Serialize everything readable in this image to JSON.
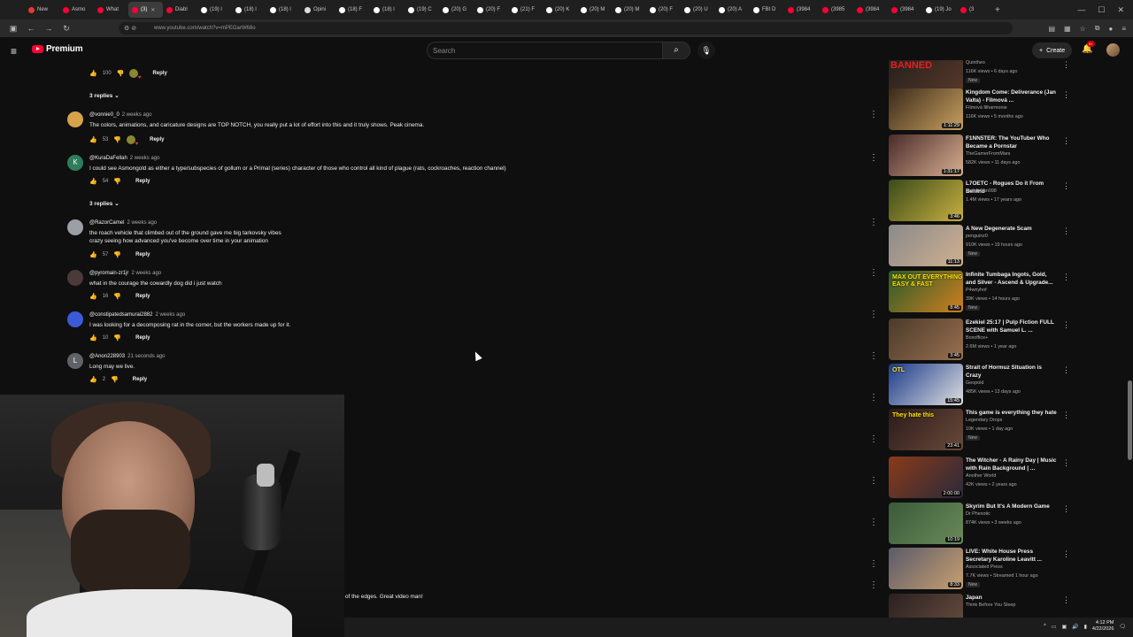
{
  "browser": {
    "tabs": [
      {
        "label": "New",
        "color": "#e03c31"
      },
      {
        "label": "Asmo",
        "color": "#ff0033"
      },
      {
        "label": "What",
        "color": "#ff0033"
      },
      {
        "label": "(3)",
        "color": "#ff0033",
        "active": true
      },
      {
        "label": "Diabl",
        "color": "#ff0033"
      },
      {
        "label": "(19) l",
        "color": "#ffffff"
      },
      {
        "label": "(18) l",
        "color": "#ffffff"
      },
      {
        "label": "(18) l",
        "color": "#ffffff"
      },
      {
        "label": "Opini",
        "color": "#dddddd"
      },
      {
        "label": "(18) F",
        "color": "#ffffff"
      },
      {
        "label": "(18) l",
        "color": "#ffffff"
      },
      {
        "label": "(19) C",
        "color": "#ffffff"
      },
      {
        "label": "(20) G",
        "color": "#ffffff"
      },
      {
        "label": "(20) F",
        "color": "#ffffff"
      },
      {
        "label": "(21) F",
        "color": "#ffffff"
      },
      {
        "label": "(20) K",
        "color": "#ffffff"
      },
      {
        "label": "(20) M",
        "color": "#ffffff"
      },
      {
        "label": "(20) M",
        "color": "#ffffff"
      },
      {
        "label": "(20) F",
        "color": "#ffffff"
      },
      {
        "label": "(20) U",
        "color": "#ffffff"
      },
      {
        "label": "(20) A",
        "color": "#ffffff"
      },
      {
        "label": "FBI D",
        "color": "#ffffff"
      },
      {
        "label": "(3984",
        "color": "#ff0033"
      },
      {
        "label": "(3985",
        "color": "#ff0033"
      },
      {
        "label": "(3984",
        "color": "#ff0033"
      },
      {
        "label": "(3984",
        "color": "#ff0033"
      },
      {
        "label": "(19) Jo",
        "color": "#ffffff"
      },
      {
        "label": "(3",
        "color": "#ff0033"
      }
    ],
    "url": "www.youtube.com/watch?v=mPEGarW68o"
  },
  "masthead": {
    "logo": "Premium",
    "search_placeholder": "Search",
    "create_label": "Create",
    "notif_count": "9+"
  },
  "comments": [
    {
      "likes": "100",
      "reply_label": "Reply",
      "heart": true
    },
    {
      "replies_label": "3 replies"
    },
    {
      "author": "@vonnie0_0",
      "time": "2 weeks ago",
      "text": "The colors, animations, and caricature designs are TOP NOTCH, you really put a lot of effort into this and it truly shows. Peak cinema.",
      "likes": "53",
      "reply_label": "Reply",
      "heart": true
    },
    {
      "author": "@KuraDaFellah",
      "time": "2 weeks ago",
      "text": "I could see Asmongold as either a type/subspecies of gollum or a Primal (series) character of those who control all kind of plague (rats, cockroaches, reaction channel)",
      "likes": "54",
      "reply_label": "Reply",
      "initial": "K"
    },
    {
      "replies_label": "3 replies"
    },
    {
      "author": "@RazorCamel",
      "time": "2 weeks ago",
      "text": "the roach vehicle that climbed out of the ground gave me big tarkovsky vibes",
      "text2": "crazy seeing how advanced you've become over time in your animation",
      "likes": "57",
      "reply_label": "Reply"
    },
    {
      "author": "@pyromain-zr1jr",
      "time": "2 weeks ago",
      "text": "what in the courage the cowardly dog did i just watch",
      "likes": "16",
      "reply_label": "Reply"
    },
    {
      "author": "@constipatedsamurai2882",
      "time": "2 weeks ago",
      "text": "I was looking for a decomposing rat in the corner, but the workers made up for it.",
      "likes": "10",
      "reply_label": "Reply"
    },
    {
      "author": "@Anon228903",
      "time": "21 seconds ago",
      "text": "Long may we live.",
      "likes": "2",
      "reply_label": "Reply",
      "initial": "L"
    }
  ],
  "partial_comment": "of the edges. Great video man!",
  "sidebar": [
    {
      "title": "",
      "channel": "Quintheo",
      "meta": "116K views • 6 days ago",
      "badge": "New",
      "duration": "12:19",
      "thumb_text": "BANNED",
      "colors": [
        "#1a1a1a",
        "#5a3a2a"
      ]
    },
    {
      "title": "Kingdom Come: Deliverance (Jan Valta) - Filmová ...",
      "channel": "Filmová filharmonie",
      "meta": "116K views • 5 months ago",
      "duration": "1:11:29",
      "colors": [
        "#3a2a1a",
        "#c8a060"
      ]
    },
    {
      "title": "F1NN5TER: The YouTuber Who Became a Pornstar",
      "channel": "TheGamerFromMars",
      "meta": "582K views • 11 days ago",
      "duration": "1:31:17",
      "colors": [
        "#4a2a2a",
        "#d8b090"
      ]
    },
    {
      "title": "L7OETC - Rogues Do it From Behind",
      "channel": "NarutoSan098",
      "meta": "1.4M views • 17 years ago",
      "duration": "3:46",
      "colors": [
        "#3a4a1a",
        "#c8b040"
      ]
    },
    {
      "title": "A New Degenerate Scam",
      "channel": "penguinz0",
      "meta": "910K views • 19 hours ago",
      "badge": "New",
      "duration": "11:13",
      "colors": [
        "#8a8a8a",
        "#d0b090"
      ]
    },
    {
      "title": "Infinite Tumbaga Ingots, Gold, and Silver - Ascend & Upgrade...",
      "channel": "P4wnyhof",
      "meta": "39K views • 14 hours ago",
      "badge": "New",
      "duration": "8:45",
      "thumb_text": "MAX OUT EVERYTHING EASY & FAST",
      "colors": [
        "#2a5a2a",
        "#d08020"
      ]
    },
    {
      "title": "Ezekiel 25:17 | Pulp Fiction FULL SCENE with Samuel L. ...",
      "channel": "Boxoffice+",
      "meta": "2.6M views • 1 year ago",
      "duration": "3:45",
      "colors": [
        "#4a3a2a",
        "#9a7050"
      ]
    },
    {
      "title": "Strait of Hormuz Situation is Crazy",
      "channel": "Geopold",
      "meta": "485K views • 13 days ago",
      "duration": "15:45",
      "thumb_text": "OTL",
      "colors": [
        "#1a3a8a",
        "#e0e0e0"
      ]
    },
    {
      "title": "This game is everything they hate",
      "channel": "Legendary Drops",
      "meta": "10K views • 1 day ago",
      "badge": "New",
      "duration": "23:41",
      "thumb_text": "They hate this",
      "colors": [
        "#2a1a1a",
        "#6a4a3a"
      ]
    },
    {
      "title": "The Witcher - A Rainy Day | Music with Rain Background | ...",
      "channel": "Another World",
      "meta": "42K views • 2 years ago",
      "duration": "2:00:00",
      "colors": [
        "#8a3a1a",
        "#2a2a3a"
      ]
    },
    {
      "title": "Skyrim But It's A Modern Game",
      "channel": "Dr Phexotic",
      "meta": "874K views • 3 weeks ago",
      "duration": "10:19",
      "colors": [
        "#3a5a3a",
        "#6a8a5a"
      ]
    },
    {
      "title": "LIVE: White House Press Secretary Karoline Leavitt ...",
      "channel": "Associated Press",
      "meta": "7.7K views • Streamed 1 hour ago",
      "badge": "New",
      "duration": "8:33",
      "colors": [
        "#5a5a6a",
        "#c8a070"
      ]
    },
    {
      "title": "Japan",
      "channel": "Think Before You Sleep",
      "meta": "",
      "duration": "",
      "colors": [
        "#2a2020",
        "#6a5040"
      ]
    }
  ],
  "taskbar": {
    "time": "4:12 PM",
    "date": "4/22/2026"
  }
}
